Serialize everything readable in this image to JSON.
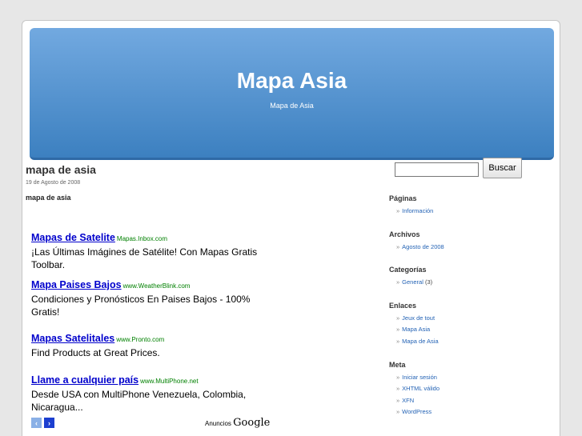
{
  "header": {
    "title": "Mapa Asia",
    "description": "Mapa de Asia"
  },
  "post": {
    "title": "mapa de asia",
    "date": "19 de Agosto de 2008",
    "label": "mapa de asia"
  },
  "ads": [
    {
      "title": "Mapas de Satelite",
      "url": "Mapas.Inbox.com",
      "desc": "¡Las Últimas Imágines de Satélite! Con Mapas Gratis Toolbar."
    },
    {
      "title": "Mapa Paises Bajos",
      "url": "www.WeatherBlink.com",
      "desc": "Condiciones y Pronósticos En Paises Bajos - 100% Gratis!"
    },
    {
      "title": "Mapas Satelitales",
      "url": "www.Pronto.com",
      "desc": "Find Products at Great Prices."
    },
    {
      "title": "Llame a cualquier país",
      "url": "www.MultiPhone.net",
      "desc": "Desde USA con MultiPhone Venezuela, Colombia, Nicaragua..."
    }
  ],
  "ad_footer": {
    "prev_icon": "left-arrow-icon",
    "next_icon": "right-arrow-icon",
    "prev_glyph": "‹",
    "next_glyph": "›",
    "ads_by": "Anuncios",
    "google": "Google"
  },
  "search": {
    "placeholder": "",
    "button_label": "Buscar"
  },
  "sidebar": {
    "paginas": {
      "heading": "Páginas",
      "items": [
        "Información"
      ]
    },
    "archivos": {
      "heading": "Archivos",
      "items": [
        "Agosto de 2008"
      ]
    },
    "categorias": {
      "heading": "Categorías",
      "items": [
        {
          "label": "General",
          "count": "(3)"
        }
      ]
    },
    "enlaces": {
      "heading": "Enlaces",
      "items": [
        "Jeux de tout",
        "Mapa Asia",
        "Mapa de Asia"
      ]
    },
    "meta": {
      "heading": "Meta",
      "items": [
        "Iniciar sesión",
        "XHTML válido",
        "XFN",
        "WordPress"
      ]
    }
  },
  "colors": {
    "header_top": "#72a9e0",
    "header_bottom": "#3c80c0",
    "link": "#2463b5",
    "ad_title": "#0000cc",
    "ad_url": "#008000"
  }
}
